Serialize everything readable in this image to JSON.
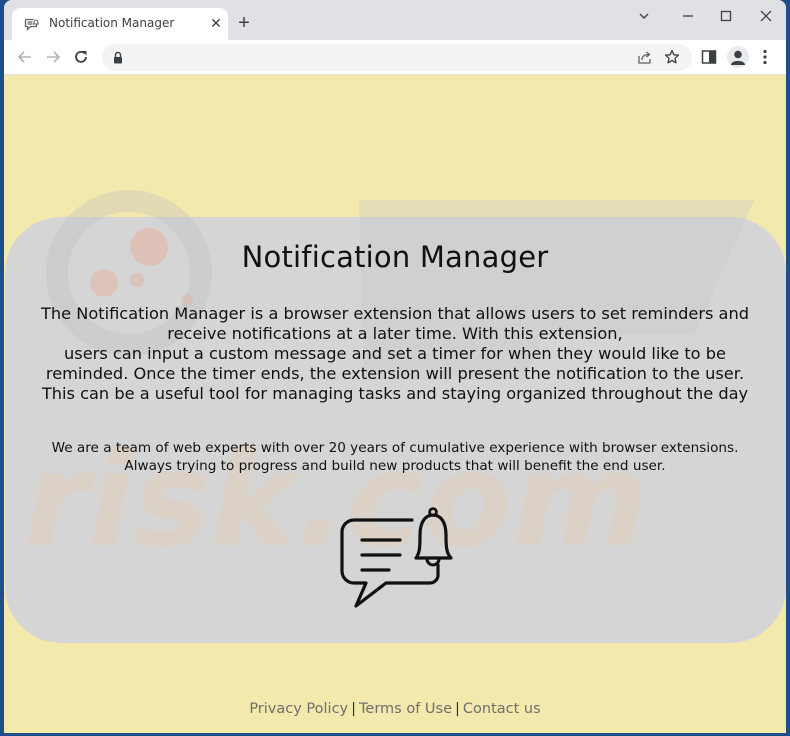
{
  "browser": {
    "tab": {
      "title": "Notification Manager",
      "icon": "chat-bell-icon",
      "close_icon": "close-icon"
    },
    "new_tab_icon": "plus-icon",
    "window_controls": [
      "chevron-down-icon",
      "minimize-icon",
      "maximize-icon",
      "close-icon"
    ],
    "toolbar": {
      "back_icon": "arrow-left-icon",
      "forward_icon": "arrow-right-icon",
      "reload_icon": "reload-icon",
      "address": "",
      "lock_icon": "lock-icon",
      "share_icon": "share-icon",
      "bookmark_icon": "star-icon",
      "side_panel_icon": "side-panel-icon",
      "profile_icon": "avatar-icon",
      "menu_icon": "kebab-menu-icon"
    }
  },
  "page": {
    "title": "Notification Manager",
    "description_lines": [
      "The Notification Manager is a browser extension that allows users to set reminders and",
      "receive notifications at a later time. With this extension,",
      "users can input a custom message and set a timer for when they would like to be",
      "reminded. Once the timer ends, the extension will present the notification to the user.",
      "This can be a useful tool for managing tasks and staying organized throughout the day"
    ],
    "about_lines": [
      "We are a team of web experts with over 20 years of cumulative experience with browser extensions.",
      "Always trying to progress and build new products that will benefit the end user."
    ],
    "hero_icon": "chat-bell-icon",
    "footer": {
      "links": [
        "Privacy Policy",
        "Terms of Use",
        "Contact us"
      ],
      "separator": "|"
    },
    "colors": {
      "background": "#f4e9ad",
      "card": "#d5d5d5",
      "text": "#111111",
      "footer_link": "#6e6e6e"
    }
  }
}
